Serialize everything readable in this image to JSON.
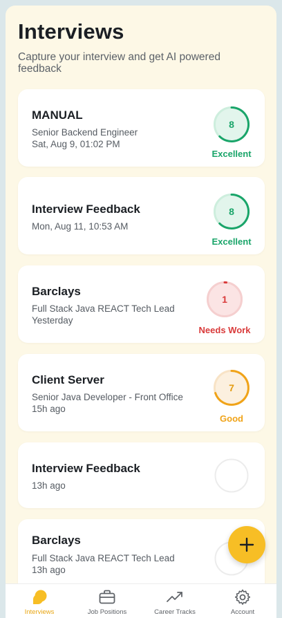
{
  "header": {
    "title": "Interviews",
    "subtitle": "Capture your interview and get AI powered feedback"
  },
  "colors": {
    "excellent": "#1aa56a",
    "needs_work": "#d93a3a",
    "good": "#f0a318",
    "fab": "#f7be25",
    "active_tab": "#e8a512"
  },
  "interviews": [
    {
      "title": "MANUAL",
      "role": "Senior Backend Engineer",
      "time": "Sat, Aug 9, 01:02 PM",
      "score": "8",
      "rating": "Excellent"
    },
    {
      "title": "Interview Feedback",
      "time": "Mon, Aug 11, 10:53 AM",
      "score": "8",
      "rating": "Excellent"
    },
    {
      "title": "Barclays",
      "role": "Full Stack Java REACT Tech Lead",
      "time": "Yesterday",
      "score": "1",
      "rating": "Needs Work"
    },
    {
      "title": "Client Server",
      "role": "Senior Java Developer - Front Office",
      "time": "15h ago",
      "score": "7",
      "rating": "Good"
    },
    {
      "title": "Interview Feedback",
      "time": "13h ago"
    },
    {
      "title": "Barclays",
      "role": "Full Stack Java REACT Tech Lead",
      "time": "13h ago"
    }
  ],
  "fab": {
    "icon": "plus-icon"
  },
  "tabs": [
    {
      "label": "Interviews",
      "icon": "chat-bubbles-icon",
      "active": true
    },
    {
      "label": "Job Positions",
      "icon": "briefcase-icon"
    },
    {
      "label": "Career Tracks",
      "icon": "trending-up-icon"
    },
    {
      "label": "Account",
      "icon": "gear-icon"
    }
  ]
}
